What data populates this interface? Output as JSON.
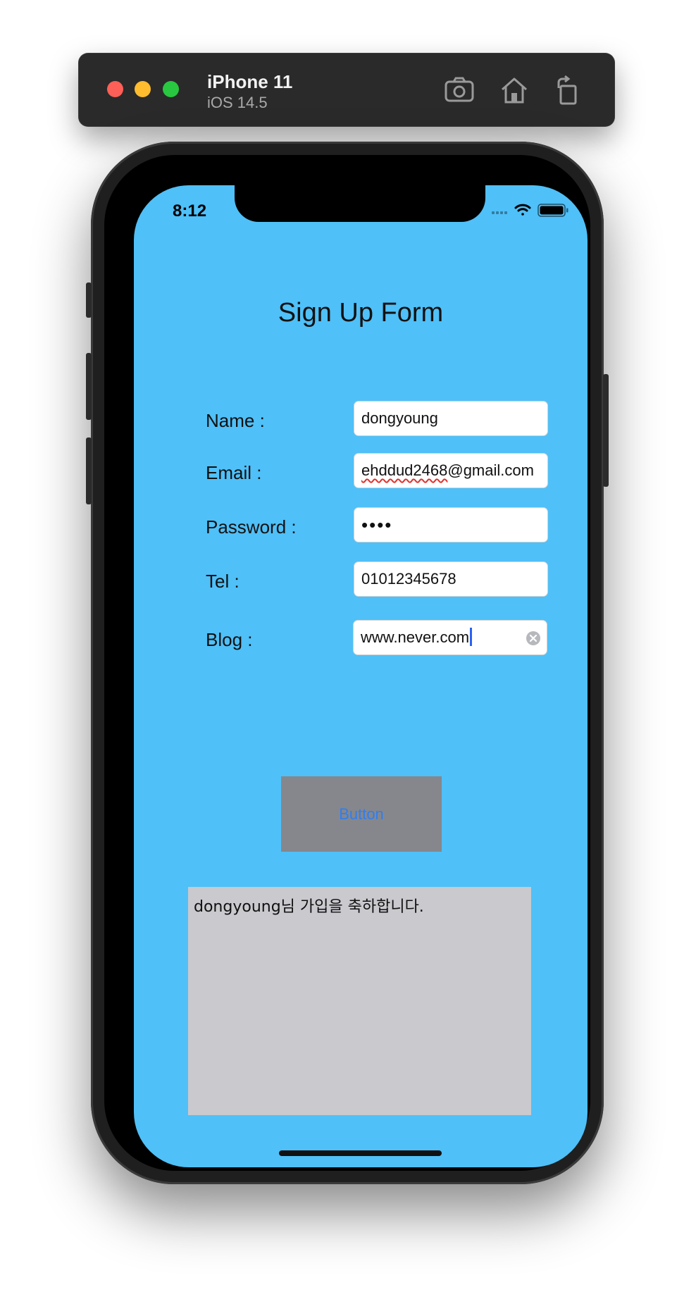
{
  "simulator": {
    "device_name": "iPhone 11",
    "os_version": "iOS 14.5",
    "toolbar_icons": [
      "screenshot-icon",
      "home-icon",
      "rotate-icon"
    ]
  },
  "status_bar": {
    "time": "8:12",
    "icons": [
      "cellular-icon",
      "wifi-icon",
      "battery-icon"
    ]
  },
  "form": {
    "title": "Sign Up Form",
    "name_label": "Name :",
    "name_value": "dongyoung",
    "email_label": "Email :",
    "email_value_misspelled": "ehddud2468",
    "email_value_rest": "@gmail.com",
    "password_label": "Password :",
    "password_value": "••••",
    "tel_label": "Tel :",
    "tel_value": "01012345678",
    "blog_label": "Blog :",
    "blog_value": "www.never.com",
    "button_label": "Button",
    "result_text": "dongyoung님 가입을 축하합니다."
  },
  "colors": {
    "screen_background": "#4fc0f8",
    "button_background": "#86878c",
    "button_text": "#2f7ef0",
    "result_background": "#c9c9ce"
  }
}
